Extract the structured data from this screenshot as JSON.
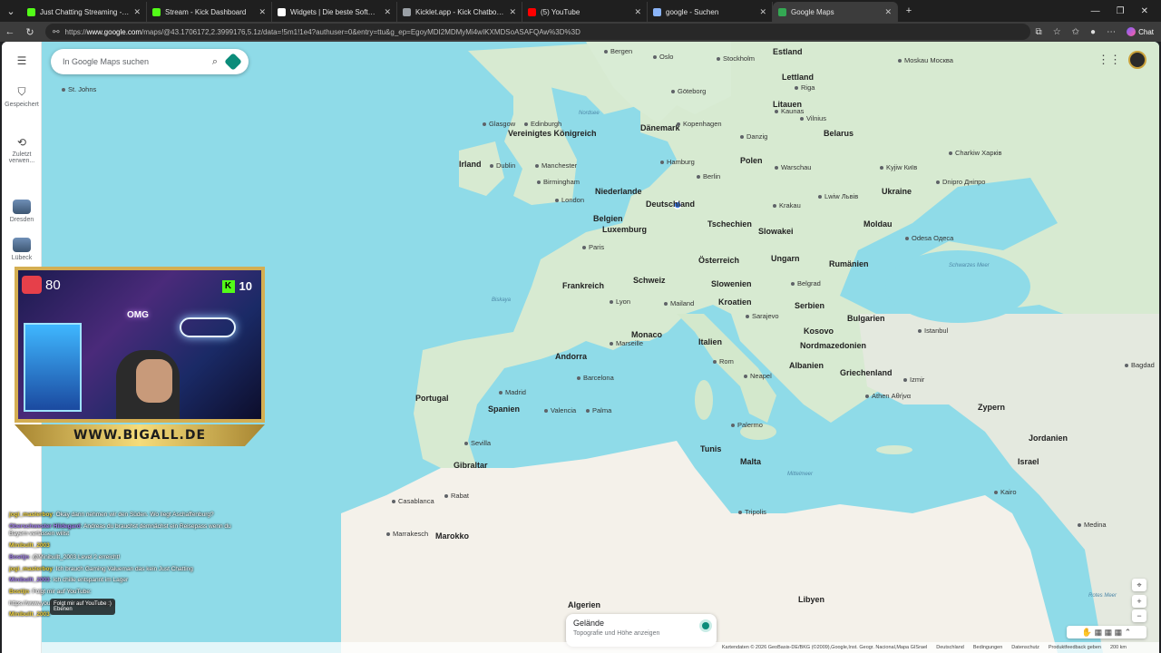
{
  "browser": {
    "tabs": [
      {
        "title": "Just Chatting Streaming - Live Stre",
        "favicon_color": "#53fc18",
        "active": false
      },
      {
        "title": "Stream - Kick Dashboard",
        "favicon_color": "#53fc18",
        "active": false
      },
      {
        "title": "Widgets | Die beste Software zur S",
        "favicon_color": "#ffffff",
        "active": false
      },
      {
        "title": "Kicklet.app - Kick Chatbot and Ove",
        "favicon_color": "#9aa0a6",
        "active": false
      },
      {
        "title": "(5) YouTube",
        "favicon_color": "#ff0000",
        "active": false
      },
      {
        "title": "google - Suchen",
        "favicon_color": "#8ab4f8",
        "active": false
      },
      {
        "title": "Google Maps",
        "favicon_color": "#34a853",
        "active": true
      }
    ],
    "url_prefix": "https://",
    "url_host": "www.google.com",
    "url_rest": "/maps/@43.1706172,2.3999176,5.1z/data=!5m1!1e4?authuser=0&entry=ttu&g_ep=EgoyMDI2MDMyMi4wIKXMDSoASAFQAw%3D%3D",
    "chat_label": "Chat"
  },
  "maps": {
    "search_placeholder": "In Google Maps suchen",
    "rail": [
      {
        "label": "Gespeichert",
        "icon": "bookmark-icon"
      },
      {
        "label": "Zuletzt verwen...",
        "icon": "history-icon"
      },
      {
        "label": "Dresden",
        "icon": "thumbnail"
      },
      {
        "label": "Lübeck",
        "icon": "thumbnail"
      }
    ],
    "terrain_title": "Gelände",
    "terrain_sub": "Topografie und Höhe anzeigen",
    "footer": [
      "Kartendaten © 2026 GeoBasis-DE/BKG (©2009),Google,Inst. Geogr. Nacional,Mapa GISrael",
      "Deutschland",
      "Bedingungen",
      "Datenschutz",
      "Produktfeedback geben",
      "200 km"
    ],
    "places": {
      "countries": [
        "Estland",
        "Lettland",
        "Litauen",
        "Dänemark",
        "Belarus",
        "Vereinigtes Königreich",
        "Irland",
        "Polen",
        "Niederlande",
        "Deutschland",
        "Belgien",
        "Luxemburg",
        "Tschechien",
        "Slowakei",
        "Ukraine",
        "Moldau",
        "Frankreich",
        "Österreich",
        "Schweiz",
        "Ungarn",
        "Rumänien",
        "Slowenien",
        "Kroatien",
        "Serbien",
        "Bulgarien",
        "Italien",
        "Kosovo",
        "Nordmazedonien",
        "Albanien",
        "Andorra",
        "Monaco",
        "Portugal",
        "Spanien",
        "Griechenland",
        "Zypern",
        "Malta",
        "Gibraltar",
        "Marokko",
        "Algerien",
        "Libyen",
        "Jordanien",
        "Israel",
        "Tunis"
      ],
      "cities": [
        "Bergen",
        "Oslo",
        "Stockholm",
        "Moskau Москва",
        "Göteborg",
        "Kopenhagen",
        "Riga",
        "Vilnius",
        "Edinburgh",
        "Glasgow",
        "Dublin",
        "Manchester",
        "Birmingham",
        "London",
        "Hamburg",
        "Berlin",
        "Danzig",
        "Warschau",
        "Krakau",
        "Kyjiw Київ",
        "Charkiw Харків",
        "Dnipro Дніпро",
        "Lwiw Львів",
        "Paris",
        "Lyon",
        "Mailand",
        "Marseille",
        "Barcelona",
        "Madrid",
        "Valencia",
        "Palma",
        "Sevilla",
        "Rom",
        "Neapel",
        "Palermo",
        "Sarajevo",
        "Belgrad",
        "Istanbul",
        "Athen Αθήνα",
        "Izmir",
        "Bagdad",
        "Rabat",
        "Casablanca",
        "Marrakesch",
        "Tripolis",
        "Kairo",
        "Medina",
        "Odesa Одеса",
        "Kaunas",
        "St. Johns"
      ],
      "seas": [
        "Nordsee",
        "Schwarzes Meer",
        "Mittelmeer",
        "Rotes Meer",
        "Biskaya"
      ]
    }
  },
  "stream": {
    "heart_rate": "80",
    "kick_count": "10",
    "banner": "WWW.BIGALL.DE",
    "neon": "OMG",
    "chat": [
      {
        "user": "jogi_masterboy",
        "text": ": Okay dann nehmen wir den Süden. Wo liegt Aschaffenburg?"
      },
      {
        "user": "Oberschwester Hildegard",
        "text": ": Andreas du brauchst demnächst ein Reisepass wenn du Bayern verlassen willst"
      },
      {
        "user": "Minibullt_2003",
        "text": ""
      },
      {
        "user": "Bostijn",
        "text": ": @Minibullt_2003 Level 2 erreicht!"
      },
      {
        "user": "jogi_masterboy",
        "text": ": Ich brauch Gaming Valueman das kein Just Chatting"
      },
      {
        "user": "Minibullt_2003",
        "text": ": Ich chille entspannt im Lager"
      },
      {
        "user": "Bostijn",
        "text": ": Folgt mir auf YouTube:"
      },
      {
        "user": "",
        "text": "https://www.youtube.com/@masterbigall"
      },
      {
        "user": "Minibullt_2003",
        "text": ""
      }
    ],
    "popup_line1": "Folgt mir auf YouTube :)",
    "popup_line2": "Ebenen"
  }
}
